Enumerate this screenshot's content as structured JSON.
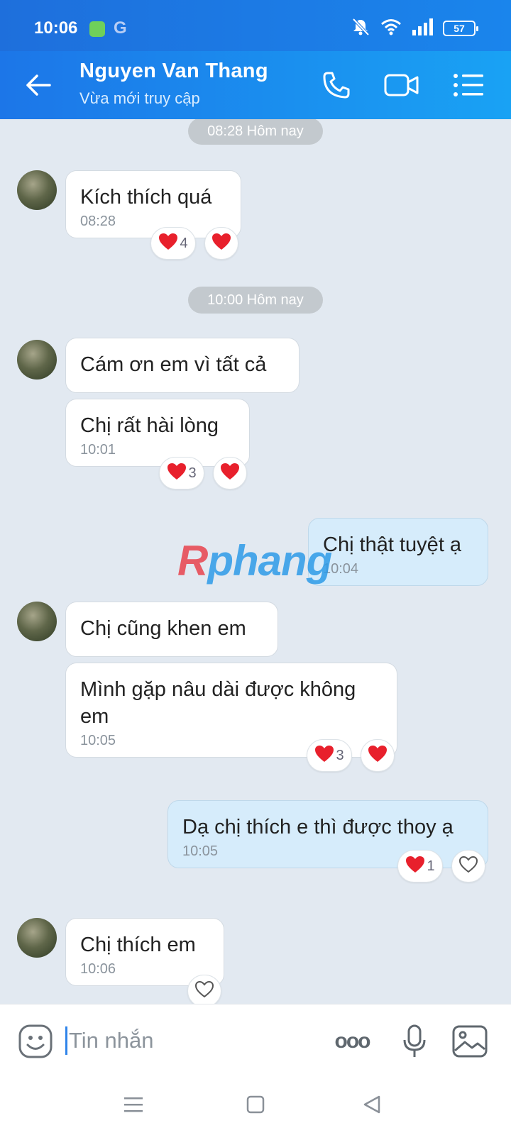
{
  "status_bar": {
    "time": "10:06",
    "google": "G",
    "battery": "57"
  },
  "header": {
    "contact_name": "Nguyen Van Thang",
    "contact_status": "Vừa mới truy cập"
  },
  "chat": {
    "timestamps": [
      "08:28 Hôm nay",
      "10:00 Hôm nay"
    ],
    "messages": [
      {
        "text": "Kích thích quá",
        "time": "08:28",
        "reaction_count": "4"
      },
      {
        "text": "Cám ơn em vì tất cả"
      },
      {
        "text": "Chị rất hài lòng",
        "time": "10:01",
        "reaction_count": "3"
      },
      {
        "text": "Chị thật tuyệt ạ",
        "time": "10:04"
      },
      {
        "text": "Chị cũng khen em"
      },
      {
        "text": "Mình gặp nâu dài được không em",
        "time": "10:05",
        "reaction_count": "3"
      },
      {
        "text": "Dạ chị thích e thì được thoy ạ",
        "time": "10:05",
        "reaction_count": "1"
      },
      {
        "text": "Chị thích em",
        "time": "10:06"
      }
    ]
  },
  "watermark": {
    "first": "R",
    "rest": "phang"
  },
  "input": {
    "placeholder": "Tin nhắn",
    "more_glyph": "ooo"
  },
  "colors": {
    "header": "#1a8ef0",
    "heart": "#e8202c",
    "outgoing_bubble": "#d6ecfb"
  }
}
